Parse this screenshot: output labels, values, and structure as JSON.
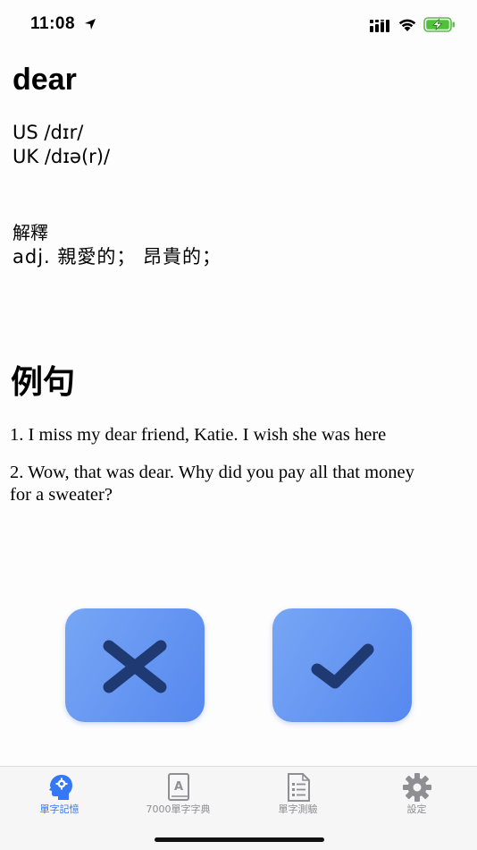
{
  "status_bar": {
    "time": "11:08"
  },
  "entry": {
    "word": "dear",
    "pronunciation_us": "US /dɪr/",
    "pronunciation_uk": "UK /dɪə(r)/",
    "definition_label": "解釋",
    "definition": "adj. 親愛的； 昂貴的；"
  },
  "examples": {
    "heading": "例句",
    "items": [
      "1. I miss my dear friend, Katie. I wish she was here",
      "2. Wow, that was dear. Why did you pay all that money for a sweater?"
    ]
  },
  "actions": {
    "wrong_icon": "x-mark-icon",
    "correct_icon": "check-mark-icon",
    "button_colors": [
      "#77a6f5",
      "#5688ef"
    ],
    "icon_color": "#1f3a72"
  },
  "tab_bar": {
    "active_color": "#3478f6",
    "inactive_color": "#8e8e93",
    "tabs": [
      {
        "label": "單字記憶",
        "icon": "brain-head-icon",
        "active": true
      },
      {
        "label": "7000單字字典",
        "icon": "dictionary-book-icon",
        "active": false
      },
      {
        "label": "單字測驗",
        "icon": "checklist-document-icon",
        "active": false
      },
      {
        "label": "設定",
        "icon": "gear-icon",
        "active": false
      }
    ]
  }
}
